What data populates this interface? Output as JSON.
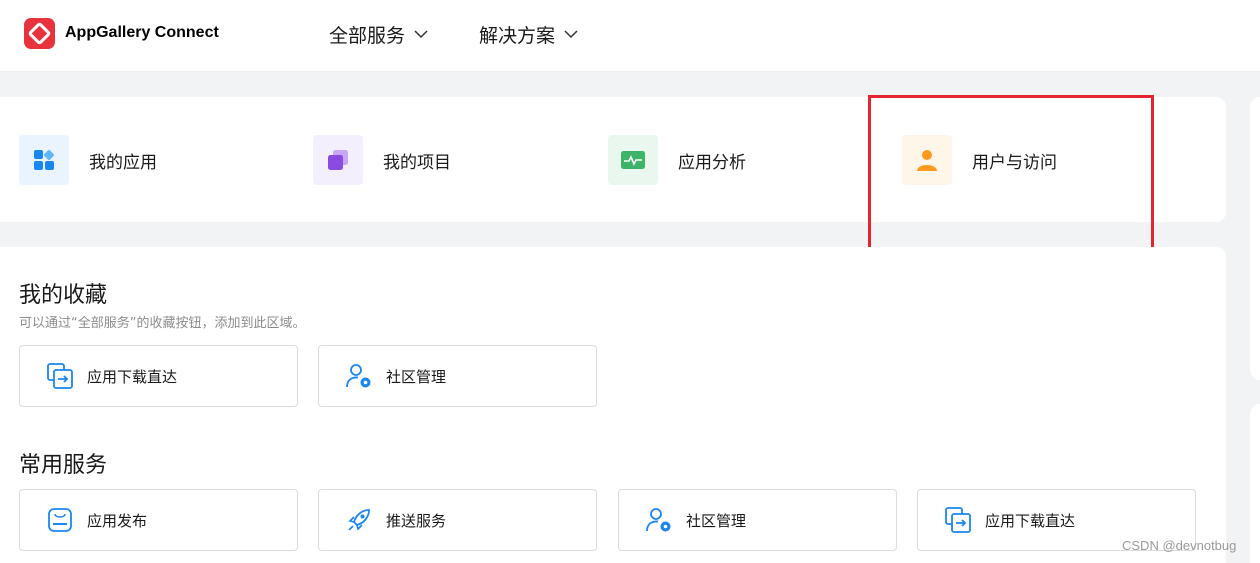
{
  "header": {
    "brand": "AppGallery Connect",
    "nav": [
      {
        "label": "全部服务"
      },
      {
        "label": "解决方案"
      }
    ]
  },
  "quick_access": [
    {
      "label": "我的应用",
      "icon": "apps-icon"
    },
    {
      "label": "我的项目",
      "icon": "projects-icon"
    },
    {
      "label": "应用分析",
      "icon": "analytics-icon"
    },
    {
      "label": "用户与访问",
      "icon": "user-icon"
    }
  ],
  "favorites": {
    "title": "我的收藏",
    "subtitle": "可以通过“全部服务”的收藏按钮，添加到此区域。",
    "items": [
      {
        "label": "应用下载直达",
        "icon": "download-direct-icon"
      },
      {
        "label": "社区管理",
        "icon": "community-admin-icon"
      }
    ]
  },
  "common": {
    "title": "常用服务",
    "items": [
      {
        "label": "应用发布",
        "icon": "app-release-icon"
      },
      {
        "label": "推送服务",
        "icon": "push-rocket-icon"
      },
      {
        "label": "社区管理",
        "icon": "community-admin-icon"
      },
      {
        "label": "应用下载直达",
        "icon": "download-direct-icon"
      }
    ]
  },
  "watermark": "CSDN @devnotbug",
  "colors": {
    "brand_red": "#e8323c",
    "accent_blue": "#1a86f0",
    "highlight_red": "#e3262f"
  }
}
